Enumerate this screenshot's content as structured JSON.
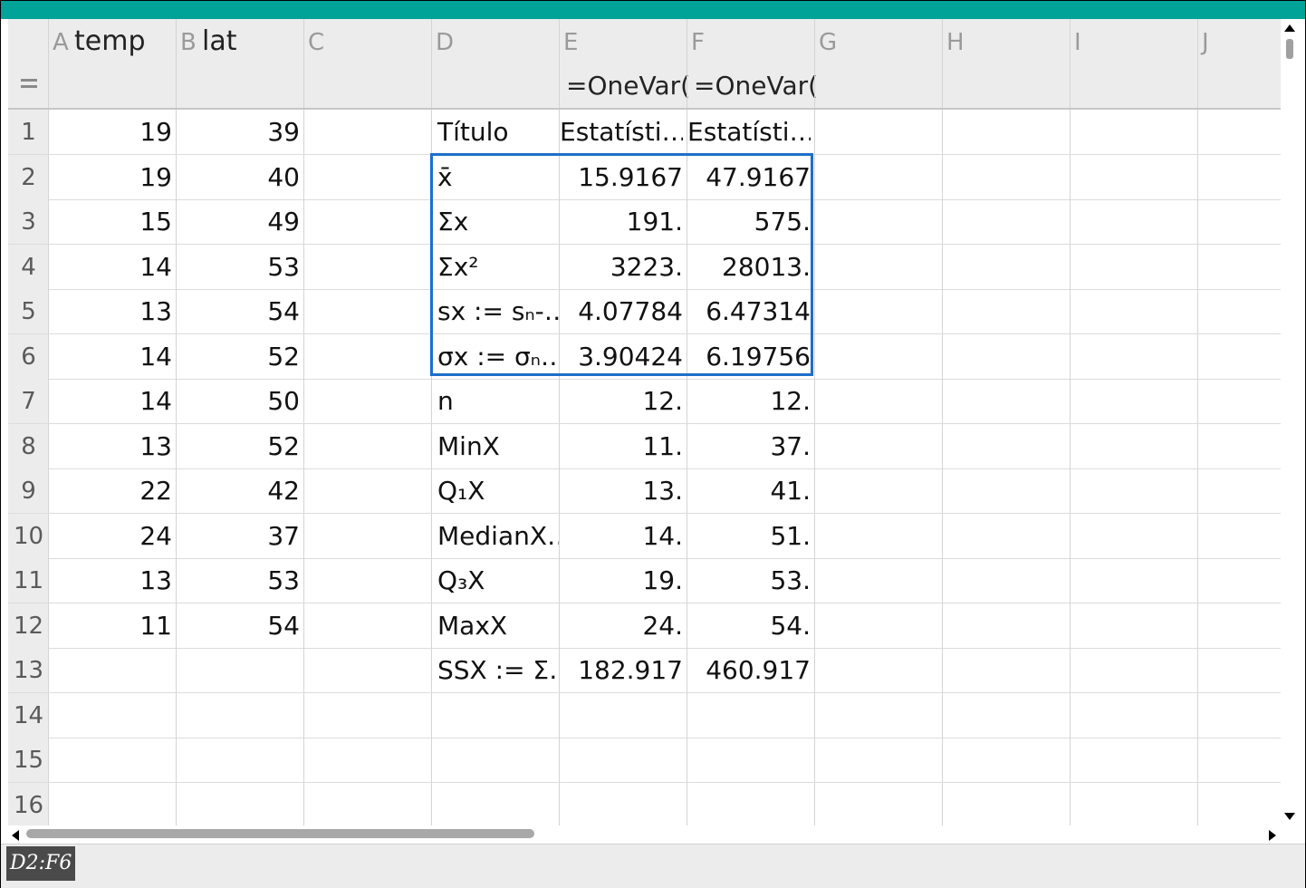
{
  "accent_color": "#00a398",
  "selection_color": "#1e6fc8",
  "columns": [
    {
      "letter": "A",
      "name": "temp"
    },
    {
      "letter": "B",
      "name": "lat"
    },
    {
      "letter": "C",
      "name": ""
    },
    {
      "letter": "D",
      "name": ""
    },
    {
      "letter": "E",
      "name": ""
    },
    {
      "letter": "F",
      "name": ""
    },
    {
      "letter": "G",
      "name": ""
    },
    {
      "letter": "H",
      "name": ""
    },
    {
      "letter": "I",
      "name": ""
    },
    {
      "letter": "J",
      "name": ""
    }
  ],
  "formula_row": {
    "menu_icon": "equals-menu-icon",
    "E": "=OneVar(",
    "F": "=OneVar("
  },
  "rows": [
    {
      "num": "1",
      "A": "19",
      "B": "39",
      "D": "Título",
      "E": "Estatísti…",
      "F": "Estatísti…"
    },
    {
      "num": "2",
      "A": "19",
      "B": "40",
      "D": "x̄",
      "E": "15.9167",
      "F": "47.9167"
    },
    {
      "num": "3",
      "A": "15",
      "B": "49",
      "D": "Σx",
      "E": "191.",
      "F": "575."
    },
    {
      "num": "4",
      "A": "14",
      "B": "53",
      "D": "Σx²",
      "E": "3223.",
      "F": "28013."
    },
    {
      "num": "5",
      "A": "13",
      "B": "54",
      "D": "sx := sₙ-…",
      "E": "4.07784",
      "F": "6.47314"
    },
    {
      "num": "6",
      "A": "14",
      "B": "52",
      "D": "σx := σₙ…",
      "E": "3.90424",
      "F": "6.19756"
    },
    {
      "num": "7",
      "A": "14",
      "B": "50",
      "D": "n",
      "E": "12.",
      "F": "12."
    },
    {
      "num": "8",
      "A": "13",
      "B": "52",
      "D": "MinX",
      "E": "11.",
      "F": "37."
    },
    {
      "num": "9",
      "A": "22",
      "B": "42",
      "D": "Q₁X",
      "E": "13.",
      "F": "41."
    },
    {
      "num": "10",
      "A": "24",
      "B": "37",
      "D": "MedianX…",
      "E": "14.",
      "F": "51."
    },
    {
      "num": "11",
      "A": "13",
      "B": "53",
      "D": "Q₃X",
      "E": "19.",
      "F": "53."
    },
    {
      "num": "12",
      "A": "11",
      "B": "54",
      "D": "MaxX",
      "E": "24.",
      "F": "54."
    },
    {
      "num": "13",
      "A": "",
      "B": "",
      "D": "SSX := Σ…",
      "E": "182.917",
      "F": "460.917"
    },
    {
      "num": "14",
      "A": "",
      "B": "",
      "D": "",
      "E": "",
      "F": ""
    },
    {
      "num": "15",
      "A": "",
      "B": "",
      "D": "",
      "E": "",
      "F": ""
    },
    {
      "num": "16",
      "A": "",
      "B": "",
      "D": "",
      "E": "",
      "F": ""
    }
  ],
  "status": {
    "cell_reference": "D2:F6"
  }
}
